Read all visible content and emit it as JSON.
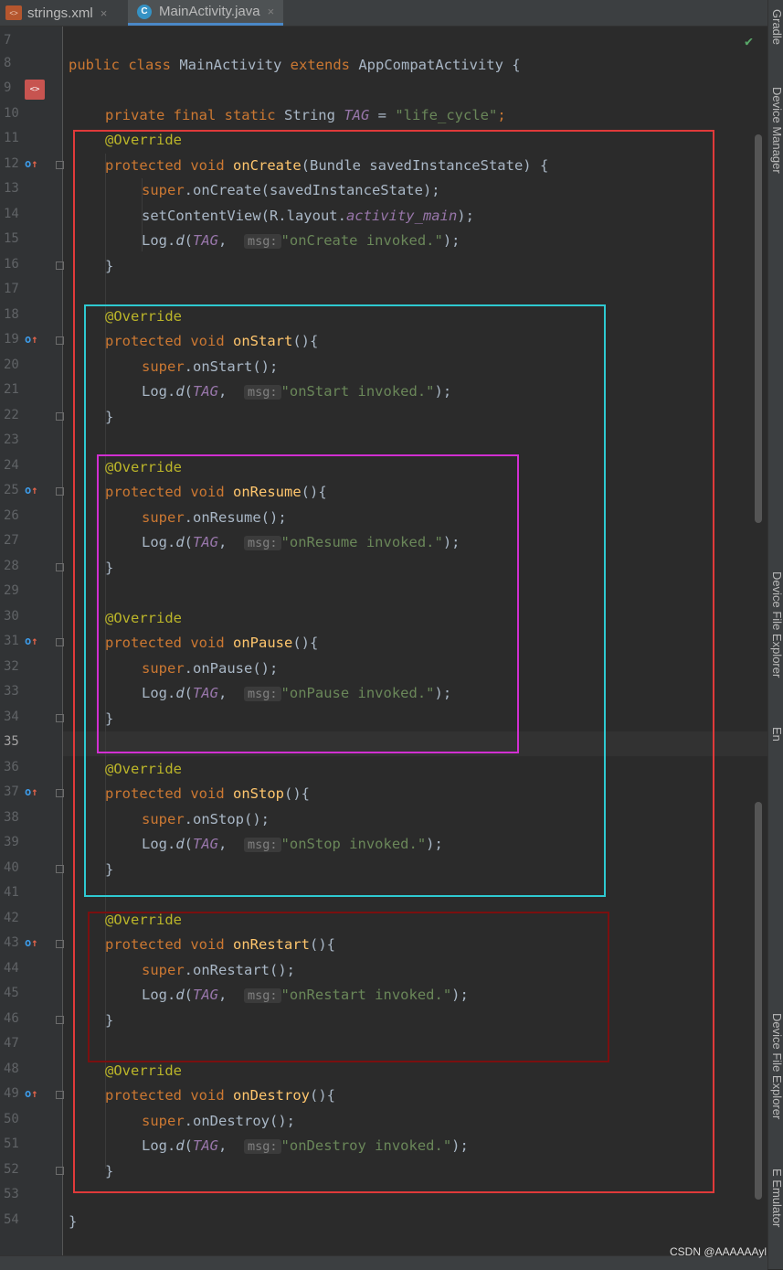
{
  "tabs": [
    {
      "label": "strings.xml",
      "icon": "xml-file-icon",
      "close": "×"
    },
    {
      "label": "MainActivity.java",
      "icon": "java-class-icon",
      "close": "×",
      "active": true
    }
  ],
  "line_numbers": [
    "7",
    "8",
    "9",
    "10",
    "11",
    "12",
    "13",
    "14",
    "15",
    "16",
    "17",
    "18",
    "19",
    "20",
    "21",
    "22",
    "23",
    "24",
    "25",
    "26",
    "27",
    "28",
    "29",
    "30",
    "31",
    "32",
    "33",
    "34",
    "35",
    "36",
    "37",
    "38",
    "39",
    "40",
    "41",
    "42",
    "43",
    "44",
    "45",
    "46",
    "47",
    "48",
    "49",
    "50",
    "51",
    "52",
    "53",
    "54"
  ],
  "current_line": "35",
  "code": {
    "class_decl": {
      "kw1": "public class",
      "name": "MainActivity",
      "kw2": "extends",
      "parent": "AppCompatActivity {"
    },
    "tag_decl": {
      "kw": "private final static",
      "type": "String",
      "name": "TAG",
      "eq": " = ",
      "value": "\"life_cycle\"",
      "end": ";"
    },
    "annotation": "@Override",
    "protected_void": "protected void",
    "super_kw": "super",
    "log": "Log.",
    "log_fn": "d",
    "tag_ref": "TAG",
    "msg_hint": "msg:",
    "close_brace": "}",
    "on_create": {
      "name": "onCreate",
      "params": "(Bundle savedInstanceState) {",
      "super_call": ".onCreate(savedInstanceState);",
      "set_content": "setContentView(R.layout.",
      "layout_name": "activity_main",
      "set_content_end": ");",
      "msg": "\"onCreate invoked.\""
    },
    "methods": [
      {
        "name": "onStart",
        "msg": "\"onStart invoked.\""
      },
      {
        "name": "onResume",
        "msg": "\"onResume invoked.\""
      },
      {
        "name": "onPause",
        "msg": "\"onPause invoked.\""
      },
      {
        "name": "onStop",
        "msg": "\"onStop invoked.\""
      },
      {
        "name": "onRestart",
        "msg": "\"onRestart invoked.\""
      },
      {
        "name": "onDestroy",
        "msg": "\"onDestroy invoked.\""
      }
    ]
  },
  "side_tools": [
    "Gradle",
    "Device Manager",
    "Device File Explorer",
    "En",
    "Device File Explorer",
    "E Emulator"
  ],
  "watermark": "CSDN @AAAAAAyl",
  "colors": {
    "red_box": "#e03a3a",
    "cyan_box": "#2ec9d1",
    "magenta_box": "#d12fd1",
    "darkred_box": "#7a0f0f"
  }
}
